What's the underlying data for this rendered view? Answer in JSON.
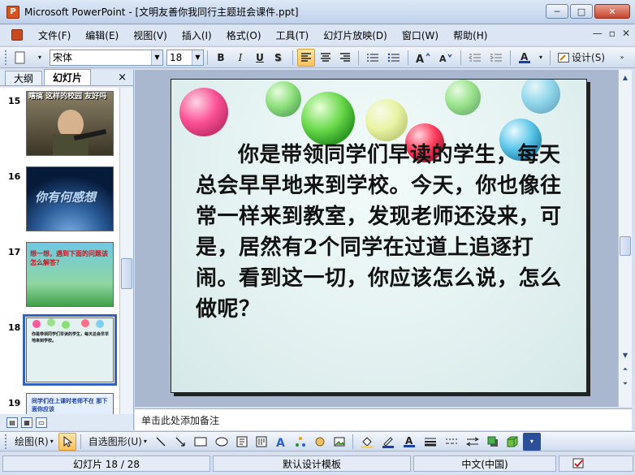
{
  "window": {
    "app_icon": "P",
    "title": "Microsoft PowerPoint - [文明友善你我同行主题班会课件.ppt]",
    "minimize": "─",
    "maximize": "□",
    "close": "✕"
  },
  "menu": {
    "items": [
      "文件(F)",
      "编辑(E)",
      "视图(V)",
      "插入(I)",
      "格式(O)",
      "工具(T)",
      "幻灯片放映(D)",
      "窗口(W)",
      "帮助(H)"
    ],
    "right_icons": [
      "—",
      "▫",
      "✕"
    ]
  },
  "toolbar": {
    "font_name": "宋体",
    "font_size": "18",
    "bold": "B",
    "italic": "I",
    "underline": "U",
    "design_label": "设计(S)"
  },
  "left_pane": {
    "tabs": [
      "大纲",
      "幻灯片"
    ],
    "close_glyph": "×",
    "slides": [
      {
        "num": "15",
        "caption": "瞎搞  这样的校园 友好吗"
      },
      {
        "num": "16",
        "caption": "你有何感想"
      },
      {
        "num": "17",
        "caption": "想一想，遇到下面的问题该怎么解答？"
      },
      {
        "num": "18",
        "caption": "你是带领同学们早读的学生，每天总会早早地来到学校。"
      },
      {
        "num": "19",
        "caption": "同学们在上课时老师不在 那下面你应该"
      }
    ]
  },
  "slide": {
    "text": "你是带领同学们早读的学生，每天总会早早地来到学校。今天，你也像往常一样来到教室，发现老师还没来，可是，居然有2个同学在过道上追逐打闹。看到这一切，你应该怎么说，怎么做呢？"
  },
  "notes": {
    "placeholder": "单击此处添加备注"
  },
  "drawbar": {
    "draw_label": "绘图(R)",
    "autoshapes_label": "自选图形(U)"
  },
  "status": {
    "slide_position": "幻灯片 18 / 28",
    "template": "默认设计模板",
    "language": "中文(中国)"
  },
  "colors": {
    "accent": "#3162c1",
    "toolbar_active": "#ffc05a",
    "slide_bg": "#e2f1f0"
  }
}
